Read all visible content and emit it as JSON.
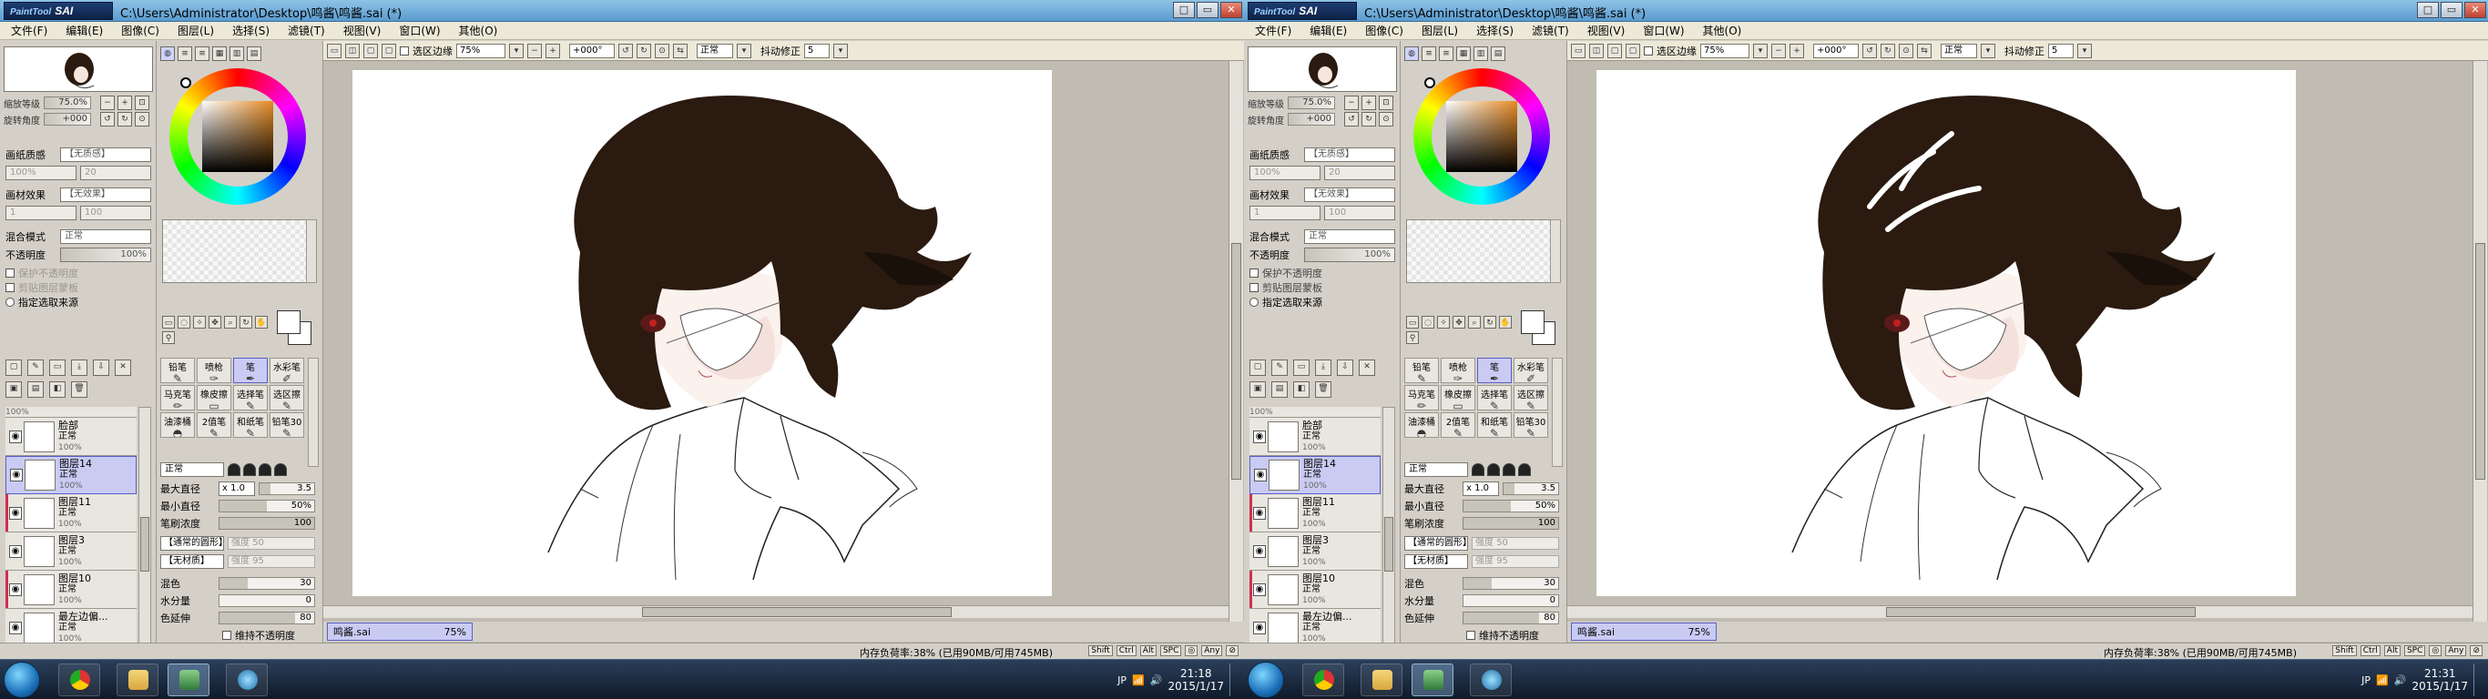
{
  "app": {
    "logo_brand": "PaintTool",
    "logo_name": "SAI",
    "document_path": "C:\\Users\\Administrator\\Desktop\\鸣酱\\鸣酱.sai (*)",
    "window_buttons": [
      "□",
      "▭",
      "✕"
    ]
  },
  "menu": [
    "文件(F)",
    "编辑(E)",
    "图像(C)",
    "图层(L)",
    "选择(S)",
    "滤镜(T)",
    "视图(V)",
    "窗口(W)",
    "其他(O)"
  ],
  "navigator": {
    "zoom_label": "缩放等级",
    "zoom_value": "75.0%",
    "rotate_label": "旋转角度",
    "rotate_value": "+000"
  },
  "layer_props": {
    "paper_texture_label": "画纸质感",
    "paper_texture_value": "【无质感】",
    "paper_effect_label": "画材效果",
    "paper_effect_value": "【无效果】",
    "blend_label": "混合模式",
    "blend_value": "正常",
    "opacity_label": "不透明度",
    "checks": [
      "保护不透明度",
      "剪贴图层蒙板",
      "指定选取来源"
    ],
    "texture_strength_a": "100%",
    "texture_strength_b": "20",
    "effect_strength_a": "1",
    "effect_strength_b": "100"
  },
  "monitor_left": {
    "opacity_value": "100%",
    "props_enabled": false,
    "layers": [
      {
        "name": "",
        "mode": "",
        "pct": "100%",
        "selected": false,
        "clip": false
      },
      {
        "name": "脸部",
        "mode": "正常",
        "pct": "100%",
        "selected": false,
        "clip": false
      },
      {
        "name": "图层14",
        "mode": "正常",
        "pct": "100%",
        "selected": true,
        "clip": false
      },
      {
        "name": "图层11",
        "mode": "正常",
        "pct": "100%",
        "selected": false,
        "clip": true
      },
      {
        "name": "图层3",
        "mode": "正常",
        "pct": "100%",
        "selected": false,
        "clip": false
      },
      {
        "name": "图层10",
        "mode": "正常",
        "pct": "100%",
        "selected": false,
        "clip": true
      },
      {
        "name": "最左边偏...",
        "mode": "正常",
        "pct": "100%",
        "selected": false,
        "clip": false
      }
    ],
    "taskbar_time": "21:18",
    "taskbar_date": "2015/1/17"
  },
  "monitor_right": {
    "opacity_value": "100%",
    "props_enabled": true,
    "layers": [
      {
        "name": "",
        "mode": "",
        "pct": "100%",
        "selected": false,
        "clip": false
      },
      {
        "name": "脸部",
        "mode": "正常",
        "pct": "100%",
        "selected": false,
        "clip": false
      },
      {
        "name": "图层14",
        "mode": "正常",
        "pct": "100%",
        "selected": true,
        "clip": false
      },
      {
        "name": "图层11",
        "mode": "正常",
        "pct": "100%",
        "selected": false,
        "clip": true
      },
      {
        "name": "图层3",
        "mode": "正常",
        "pct": "100%",
        "selected": false,
        "clip": false
      },
      {
        "name": "图层10",
        "mode": "正常",
        "pct": "100%",
        "selected": false,
        "clip": true
      },
      {
        "name": "最左边偏...",
        "mode": "正常",
        "pct": "100%",
        "selected": false,
        "clip": false
      }
    ],
    "taskbar_time": "21:31",
    "taskbar_date": "2015/1/17"
  },
  "tools": [
    {
      "label": "铅笔",
      "glyph": "✎"
    },
    {
      "label": "喷枪",
      "glyph": "✑"
    },
    {
      "label": "笔",
      "glyph": "✒",
      "selected": true
    },
    {
      "label": "水彩笔",
      "glyph": "✐"
    },
    {
      "label": "马克笔",
      "glyph": "✏"
    },
    {
      "label": "橡皮擦",
      "glyph": "▭"
    },
    {
      "label": "选择笔",
      "glyph": "✎"
    },
    {
      "label": "选区擦",
      "glyph": "✎"
    },
    {
      "label": "油漆桶",
      "glyph": "◓"
    },
    {
      "label": "2值笔",
      "glyph": "✎"
    },
    {
      "label": "和纸笔",
      "glyph": "✎"
    },
    {
      "label": "铅笔30",
      "glyph": "✎"
    }
  ],
  "brush": {
    "mode": "正常",
    "max_size_label": "最大直径",
    "max_size_mult": "x 1.0",
    "max_size_value": "3.5",
    "min_size_label": "最小直径",
    "min_size_value": "50%",
    "density_label": "笔刷浓度",
    "density_value": "100",
    "shape_value": "【通常的圆形】",
    "shape_strength": "强度",
    "shape_strength_value": "50",
    "texture_value": "【无材质】",
    "texture_strength": "强度",
    "texture_strength_value": "95",
    "blend_label": "混色",
    "blend_value": "30",
    "water_label": "水分量",
    "water_value": "0",
    "stretch_label": "色延伸",
    "stretch_value": "80",
    "keep_opacity_label": "维持不透明度"
  },
  "canvas_toolbar": {
    "show_selection": "选区边缘",
    "zoom": "75%",
    "rotation": "+000°",
    "mode": "正常",
    "stabilizer_label": "抖动修正",
    "stabilizer_value": "5"
  },
  "doc_tab": {
    "name": "鸣酱.sai",
    "zoom": "75%"
  },
  "status": {
    "memory": "内存负荷率:38% (已用90MB/可用745MB)",
    "keys": [
      "Shift",
      "Ctrl",
      "Alt",
      "SPC",
      "◎",
      "Any",
      "⊘"
    ]
  },
  "colors": {
    "accent": "#5a5ec8",
    "selected_bg": "#c9cbf3",
    "hair": "#2a1a10",
    "clip_red": "#d03050"
  }
}
